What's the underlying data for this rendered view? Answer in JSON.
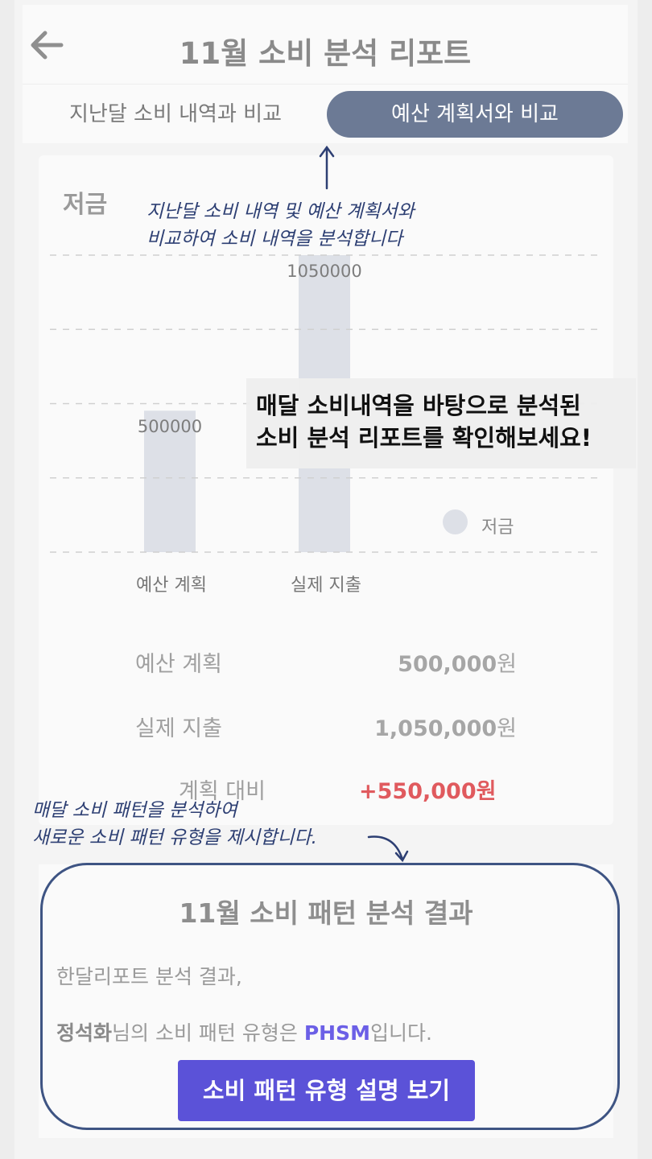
{
  "header": {
    "title": "11월 소비 분석 리포트"
  },
  "tabs": [
    {
      "label": "지난달 소비 내역과 비교"
    },
    {
      "label": "예산 계획서와 비교"
    }
  ],
  "chart_card": {
    "category_title": "저금",
    "legend": "저금",
    "summary": {
      "budget_label": "예산 계획",
      "budget_value": "500,000",
      "actual_label": "실제 지출",
      "actual_value": "1,050,000",
      "won": "원",
      "diff_label": "계획 대비",
      "diff_value": "+550,000원"
    }
  },
  "chart_data": {
    "type": "bar",
    "categories": [
      "예산 계획",
      "실제 지출"
    ],
    "values": [
      500000,
      1050000
    ],
    "value_labels": [
      "500000",
      "1050000"
    ],
    "title": "저금",
    "legend": [
      "저금"
    ],
    "ylim": [
      0,
      1050000
    ],
    "grid": true,
    "colors": {
      "bar": "#dde0e7",
      "grid": "#d0d0d0"
    }
  },
  "tooltip": {
    "line1": "매달 소비내역을 바탕으로 분석된",
    "line2": "소비 분석 리포트를 확인해보세요!"
  },
  "notes": {
    "top_line1": "지난달 소비 내역 및 예산 계획서와",
    "top_line2": "비교하여 소비 내역을 분석합니다",
    "bottom_line1": "매달 소비 패턴을 분석하여",
    "bottom_line2": "새로운 소비 패턴 유형을 제시합니다."
  },
  "pattern": {
    "title": "11월 소비 패턴 분석 결과",
    "line1": "한달리포트 분석 결과,",
    "user_name": "정석화",
    "line2_mid": "님의 소비 패턴 유형은 ",
    "code": "PHSM",
    "line2_end": "입니다.",
    "button": "소비 패턴 유형 설명 보기"
  },
  "colors": {
    "accent": "#5b52d8",
    "tab_active": "#6c7a95",
    "diff_red": "#e05a5e",
    "annotation": "#2d3f73"
  }
}
